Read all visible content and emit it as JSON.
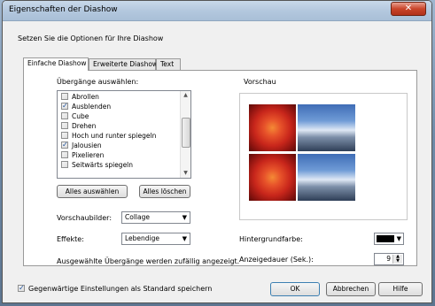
{
  "window": {
    "title": "Eigenschaften der Diashow",
    "close_symbol": "✕"
  },
  "intro": "Setzen Sie die Optionen für Ihre Diashow",
  "tabs": [
    {
      "label": "Einfache Diashow",
      "active": true
    },
    {
      "label": "Erweiterte Diashow",
      "active": false
    },
    {
      "label": "Text",
      "active": false
    }
  ],
  "transitions": {
    "label": "Übergänge auswählen:",
    "items": [
      {
        "label": "Abrollen",
        "checked": false
      },
      {
        "label": "Ausblenden",
        "checked": true
      },
      {
        "label": "Cube",
        "checked": false
      },
      {
        "label": "Drehen",
        "checked": false
      },
      {
        "label": "Hoch und runter spiegeln",
        "checked": false
      },
      {
        "label": "Jalousien",
        "checked": true
      },
      {
        "label": "Pixelieren",
        "checked": false
      },
      {
        "label": "Seitwärts spiegeln",
        "checked": false
      }
    ],
    "select_all": "Alles auswählen",
    "clear_all": "Alles löschen"
  },
  "thumbnails": {
    "label": "Vorschaubilder:",
    "value": "Collage"
  },
  "effects": {
    "label": "Effekte:",
    "value": "Lebendige"
  },
  "note": "Ausgewählte Übergänge werden zufällig angezeigt.",
  "preview": {
    "label": "Vorschau"
  },
  "background_color": {
    "label": "Hintergrundfarbe:",
    "color": "#000000"
  },
  "duration": {
    "label": "Anzeigedauer (Sek.):",
    "value": "9"
  },
  "footer": {
    "save_default_label": "Gegenwärtige Einstellungen als Standard speichern",
    "save_default_checked": true,
    "ok": "OK",
    "cancel": "Abbrechen",
    "help": "Hilfe"
  }
}
